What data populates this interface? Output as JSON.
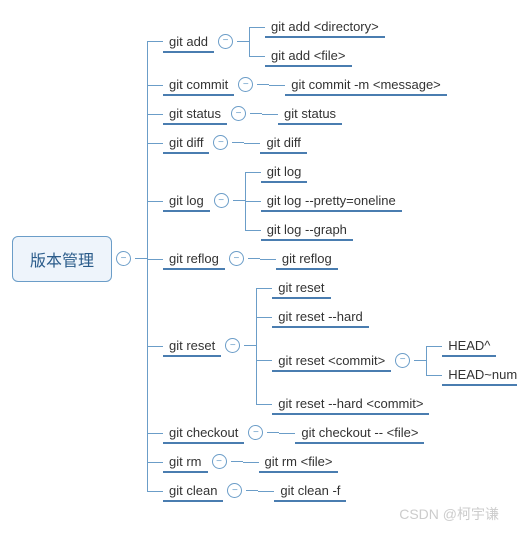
{
  "root": {
    "label": "版本管理"
  },
  "toggle_glyph": "−",
  "watermark": "CSDN @柯宇谦",
  "nodes": {
    "git_add": {
      "label": "git add",
      "children": [
        "git add <directory>",
        "git add <file>"
      ]
    },
    "git_commit": {
      "label": "git commit",
      "children": [
        "git commit -m <message>"
      ]
    },
    "git_status": {
      "label": "git status",
      "children": [
        "git status"
      ]
    },
    "git_diff": {
      "label": "git diff",
      "children": [
        "git diff"
      ]
    },
    "git_log": {
      "label": "git log",
      "children": [
        "git log",
        "git log --pretty=oneline",
        "git log --graph"
      ]
    },
    "git_reflog": {
      "label": "git reflog",
      "children": [
        "git reflog"
      ]
    },
    "git_reset": {
      "label": "git reset",
      "children": [
        "git reset",
        "git reset --hard",
        {
          "label": "git reset <commit>",
          "children": [
            "HEAD^",
            "HEAD~num"
          ]
        },
        "git reset --hard <commit>"
      ]
    },
    "git_checkout": {
      "label": "git checkout",
      "children": [
        "git checkout -- <file>"
      ]
    },
    "git_rm": {
      "label": "git rm",
      "children": [
        "git rm <file>"
      ]
    },
    "git_clean": {
      "label": "git clean",
      "children": [
        "git clean -f"
      ]
    }
  },
  "order": [
    "git_add",
    "git_commit",
    "git_status",
    "git_diff",
    "git_log",
    "git_reflog",
    "git_reset",
    "git_checkout",
    "git_rm",
    "git_clean"
  ]
}
